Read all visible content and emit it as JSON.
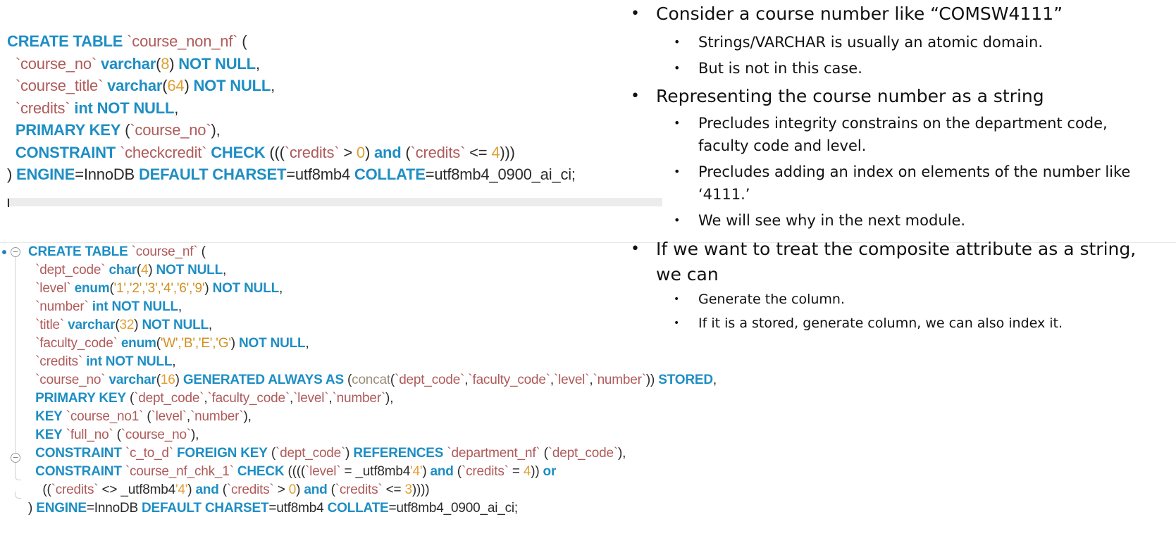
{
  "code_block_1": {
    "lines": [
      [
        [
          "kw",
          "CREATE TABLE "
        ],
        [
          "id",
          "`course_non_nf`"
        ],
        [
          "pl",
          " ("
        ]
      ],
      [
        [
          "pl",
          "  "
        ],
        [
          "id",
          "`course_no`"
        ],
        [
          "pl",
          " "
        ],
        [
          "kw",
          "varchar"
        ],
        [
          "pl",
          "("
        ],
        [
          "num",
          "8"
        ],
        [
          "pl",
          ") "
        ],
        [
          "kw",
          "NOT NULL"
        ],
        [
          "pl",
          ","
        ]
      ],
      [
        [
          "pl",
          "  "
        ],
        [
          "id",
          "`course_title`"
        ],
        [
          "pl",
          " "
        ],
        [
          "kw",
          "varchar"
        ],
        [
          "pl",
          "("
        ],
        [
          "num",
          "64"
        ],
        [
          "pl",
          ") "
        ],
        [
          "kw",
          "NOT NULL"
        ],
        [
          "pl",
          ","
        ]
      ],
      [
        [
          "pl",
          "  "
        ],
        [
          "id",
          "`credits`"
        ],
        [
          "pl",
          " "
        ],
        [
          "kw",
          "int NOT NULL"
        ],
        [
          "pl",
          ","
        ]
      ],
      [
        [
          "pl",
          "  "
        ],
        [
          "kw",
          "PRIMARY KEY"
        ],
        [
          "pl",
          " ("
        ],
        [
          "id",
          "`course_no`"
        ],
        [
          "pl",
          "),"
        ]
      ],
      [
        [
          "pl",
          "  "
        ],
        [
          "kw",
          "CONSTRAINT"
        ],
        [
          "pl",
          " "
        ],
        [
          "id",
          "`checkcredit`"
        ],
        [
          "pl",
          " "
        ],
        [
          "kw",
          "CHECK"
        ],
        [
          "pl",
          " ((("
        ],
        [
          "id",
          "`credits`"
        ],
        [
          "pl",
          " > "
        ],
        [
          "num",
          "0"
        ],
        [
          "pl",
          ") "
        ],
        [
          "kw",
          "and"
        ],
        [
          "pl",
          " ("
        ],
        [
          "id",
          "`credits`"
        ],
        [
          "pl",
          " <= "
        ],
        [
          "num",
          "4"
        ],
        [
          "pl",
          ")))"
        ]
      ],
      [
        [
          "pl",
          ") "
        ],
        [
          "kw",
          "ENGINE"
        ],
        [
          "pl",
          "=InnoDB "
        ],
        [
          "kw",
          "DEFAULT CHARSET"
        ],
        [
          "pl",
          "=utf8mb4 "
        ],
        [
          "kw",
          "COLLATE"
        ],
        [
          "pl",
          "=utf8mb4_0900_ai_ci;"
        ]
      ]
    ]
  },
  "code_block_2": {
    "lines": [
      [
        [
          "kw",
          "CREATE TABLE "
        ],
        [
          "id",
          "`course_nf`"
        ],
        [
          "pl",
          " ("
        ]
      ],
      [
        [
          "pl",
          "  "
        ],
        [
          "id",
          "`dept_code`"
        ],
        [
          "pl",
          " "
        ],
        [
          "kw",
          "char"
        ],
        [
          "pl",
          "("
        ],
        [
          "num",
          "4"
        ],
        [
          "pl",
          ") "
        ],
        [
          "kw",
          "NOT NULL"
        ],
        [
          "pl",
          ","
        ]
      ],
      [
        [
          "pl",
          "  "
        ],
        [
          "id",
          "`level`"
        ],
        [
          "pl",
          " "
        ],
        [
          "kw",
          "enum"
        ],
        [
          "pl",
          "("
        ],
        [
          "str",
          "'1','2','3','4','6','9'"
        ],
        [
          "pl",
          ") "
        ],
        [
          "kw",
          "NOT NULL"
        ],
        [
          "pl",
          ","
        ]
      ],
      [
        [
          "pl",
          "  "
        ],
        [
          "id",
          "`number`"
        ],
        [
          "pl",
          " "
        ],
        [
          "kw",
          "int NOT NULL"
        ],
        [
          "pl",
          ","
        ]
      ],
      [
        [
          "pl",
          "  "
        ],
        [
          "id",
          "`title`"
        ],
        [
          "pl",
          " "
        ],
        [
          "kw",
          "varchar"
        ],
        [
          "pl",
          "("
        ],
        [
          "num",
          "32"
        ],
        [
          "pl",
          ") "
        ],
        [
          "kw",
          "NOT NULL"
        ],
        [
          "pl",
          ","
        ]
      ],
      [
        [
          "pl",
          "  "
        ],
        [
          "id",
          "`faculty_code`"
        ],
        [
          "pl",
          " "
        ],
        [
          "kw",
          "enum"
        ],
        [
          "pl",
          "("
        ],
        [
          "str",
          "'W','B','E','G'"
        ],
        [
          "pl",
          ") "
        ],
        [
          "kw",
          "NOT NULL"
        ],
        [
          "pl",
          ","
        ]
      ],
      [
        [
          "pl",
          "  "
        ],
        [
          "id",
          "`credits`"
        ],
        [
          "pl",
          " "
        ],
        [
          "kw",
          "int NOT NULL"
        ],
        [
          "pl",
          ","
        ]
      ],
      [
        [
          "pl",
          "  "
        ],
        [
          "id",
          "`course_no`"
        ],
        [
          "pl",
          " "
        ],
        [
          "kw",
          "varchar"
        ],
        [
          "pl",
          "("
        ],
        [
          "num",
          "16"
        ],
        [
          "pl",
          ") "
        ],
        [
          "kw",
          "GENERATED ALWAYS AS"
        ],
        [
          "pl",
          " ("
        ],
        [
          "fn",
          "concat"
        ],
        [
          "pl",
          "("
        ],
        [
          "id",
          "`dept_code`"
        ],
        [
          "pl",
          ","
        ],
        [
          "id",
          "`faculty_code`"
        ],
        [
          "pl",
          ","
        ],
        [
          "id",
          "`level`"
        ],
        [
          "pl",
          ","
        ],
        [
          "id",
          "`number`"
        ],
        [
          "pl",
          ")) "
        ],
        [
          "kw",
          "STORED"
        ],
        [
          "pl",
          ","
        ]
      ],
      [
        [
          "pl",
          "  "
        ],
        [
          "kw",
          "PRIMARY KEY"
        ],
        [
          "pl",
          " ("
        ],
        [
          "id",
          "`dept_code`"
        ],
        [
          "pl",
          ","
        ],
        [
          "id",
          "`faculty_code`"
        ],
        [
          "pl",
          ","
        ],
        [
          "id",
          "`level`"
        ],
        [
          "pl",
          ","
        ],
        [
          "id",
          "`number`"
        ],
        [
          "pl",
          "),"
        ]
      ],
      [
        [
          "pl",
          "  "
        ],
        [
          "kw",
          "KEY"
        ],
        [
          "pl",
          " "
        ],
        [
          "id",
          "`course_no1`"
        ],
        [
          "pl",
          " ("
        ],
        [
          "id",
          "`level`"
        ],
        [
          "pl",
          ","
        ],
        [
          "id",
          "`number`"
        ],
        [
          "pl",
          "),"
        ]
      ],
      [
        [
          "pl",
          "  "
        ],
        [
          "kw",
          "KEY"
        ],
        [
          "pl",
          " "
        ],
        [
          "id",
          "`full_no`"
        ],
        [
          "pl",
          " ("
        ],
        [
          "id",
          "`course_no`"
        ],
        [
          "pl",
          "),"
        ]
      ],
      [
        [
          "pl",
          "  "
        ],
        [
          "kw",
          "CONSTRAINT"
        ],
        [
          "pl",
          " "
        ],
        [
          "id",
          "`c_to_d`"
        ],
        [
          "pl",
          " "
        ],
        [
          "kw",
          "FOREIGN KEY"
        ],
        [
          "pl",
          " ("
        ],
        [
          "id",
          "`dept_code`"
        ],
        [
          "pl",
          ") "
        ],
        [
          "kw",
          "REFERENCES"
        ],
        [
          "pl",
          " "
        ],
        [
          "id",
          "`department_nf`"
        ],
        [
          "pl",
          " ("
        ],
        [
          "id",
          "`dept_code`"
        ],
        [
          "pl",
          "),"
        ]
      ],
      [
        [
          "pl",
          "  "
        ],
        [
          "kw",
          "CONSTRAINT"
        ],
        [
          "pl",
          " "
        ],
        [
          "id",
          "`course_nf_chk_1`"
        ],
        [
          "pl",
          " "
        ],
        [
          "kw",
          "CHECK"
        ],
        [
          "pl",
          " (((("
        ],
        [
          "id",
          "`level`"
        ],
        [
          "pl",
          " = _utf8mb4"
        ],
        [
          "num",
          "'4'"
        ],
        [
          "pl",
          ") "
        ],
        [
          "kw",
          "and"
        ],
        [
          "pl",
          " ("
        ],
        [
          "id",
          "`credits`"
        ],
        [
          "pl",
          " = "
        ],
        [
          "num",
          "4"
        ],
        [
          "pl",
          ")) "
        ],
        [
          "kw",
          "or"
        ]
      ],
      [
        [
          "pl",
          "    (("
        ],
        [
          "id",
          "`credits`"
        ],
        [
          "pl",
          " <> _utf8mb4"
        ],
        [
          "num",
          "'4'"
        ],
        [
          "pl",
          ") "
        ],
        [
          "kw",
          "and"
        ],
        [
          "pl",
          " ("
        ],
        [
          "id",
          "`credits`"
        ],
        [
          "pl",
          " > "
        ],
        [
          "num",
          "0"
        ],
        [
          "pl",
          ") "
        ],
        [
          "kw",
          "and"
        ],
        [
          "pl",
          " ("
        ],
        [
          "id",
          "`credits`"
        ],
        [
          "pl",
          " <= "
        ],
        [
          "num",
          "3"
        ],
        [
          "pl",
          "))))"
        ]
      ],
      [
        [
          "pl",
          ") "
        ],
        [
          "kw",
          "ENGINE"
        ],
        [
          "pl",
          "=InnoDB "
        ],
        [
          "kw",
          "DEFAULT CHARSET"
        ],
        [
          "pl",
          "=utf8mb4 "
        ],
        [
          "kw",
          "COLLATE"
        ],
        [
          "pl",
          "=utf8mb4_0900_ai_ci;"
        ]
      ]
    ]
  },
  "notes": {
    "b1": "Consider a course number like “COMSW4111”",
    "b1_1": "Strings/VARCHAR is usually an atomic domain.",
    "b1_2": "But is not in this case.",
    "b2": "Representing the course number as a string",
    "b2_1a": "Precludes integrity constrains on the department code,",
    "b2_1b": "faculty code and level.",
    "b2_2a": "Precludes adding an index on elements of the number like",
    "b2_2b": "‘4111.’",
    "b2_3": "We will see why in the next module.",
    "b3a": "If we want to treat the composite attribute as a string,",
    "b3b": "we can",
    "b3_1": "Generate the column.",
    "b3_2": "If it is a stored, generate column, we can also index it.",
    "bullet_glyph": "•"
  }
}
